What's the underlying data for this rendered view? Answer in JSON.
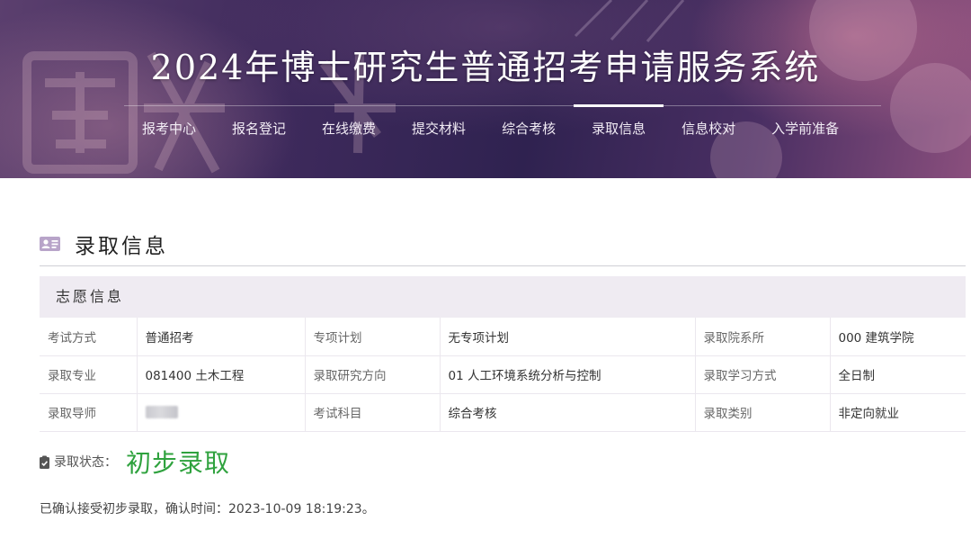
{
  "header": {
    "title": "2024年博士研究生普通招考申请服务系统",
    "nav": [
      {
        "label": "报考中心",
        "active": false
      },
      {
        "label": "报名登记",
        "active": false
      },
      {
        "label": "在线缴费",
        "active": false
      },
      {
        "label": "提交材料",
        "active": false
      },
      {
        "label": "综合考核",
        "active": false
      },
      {
        "label": "录取信息",
        "active": true
      },
      {
        "label": "信息校对",
        "active": false
      },
      {
        "label": "入学前准备",
        "active": false
      }
    ]
  },
  "section": {
    "title": "录取信息",
    "icon": "id-card-icon"
  },
  "panel": {
    "title": "志愿信息",
    "rows": [
      [
        {
          "label": "考试方式",
          "value": "普通招考"
        },
        {
          "label": "专项计划",
          "value": "无专项计划"
        },
        {
          "label": "录取院系所",
          "value": "000 建筑学院"
        }
      ],
      [
        {
          "label": "录取专业",
          "value": "081400 土木工程"
        },
        {
          "label": "录取研究方向",
          "value": "01 人工环境系统分析与控制"
        },
        {
          "label": "录取学习方式",
          "value": "全日制"
        }
      ],
      [
        {
          "label": "录取导师",
          "value": ""
        },
        {
          "label": "考试科目",
          "value": "综合考核"
        },
        {
          "label": "录取类别",
          "value": "非定向就业"
        }
      ]
    ]
  },
  "status": {
    "label": "录取状态：",
    "value": "初步录取",
    "value_color": "#2fa23e",
    "icon": "clipboard-check-icon"
  },
  "confirm_text": "已确认接受初步录取，确认时间：2023-10-09 18:19:23。",
  "colors": {
    "accent": "#8a6fa3",
    "panel_header_bg": "#efebf2"
  }
}
